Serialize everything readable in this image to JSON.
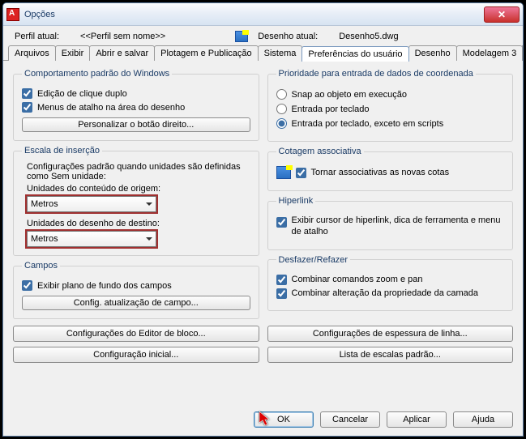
{
  "window": {
    "title": "Opções"
  },
  "header": {
    "profile_label": "Perfil atual:",
    "profile_value": "<<Perfil sem nome>>",
    "drawing_label": "Desenho atual:",
    "drawing_value": "Desenho5.dwg"
  },
  "tabs": {
    "items": [
      "Arquivos",
      "Exibir",
      "Abrir e salvar",
      "Plotagem e Publicação",
      "Sistema",
      "Preferências do usuário",
      "Desenho",
      "Modelagem 3"
    ],
    "active_index": 5
  },
  "left": {
    "win_behavior": {
      "legend": "Comportamento padrão do Windows",
      "dbl_click": "Edição de clique duplo",
      "shortcut_menus": "Menus de atalho na área do desenho",
      "custom_btn": "Personalizar o botão direito..."
    },
    "insert_scale": {
      "legend": "Escala de inserção",
      "desc": "Configurações padrão quando unidades são definidas como Sem unidade:",
      "src_label": "Unidades do conteúdo de origem:",
      "src_value": "Metros",
      "tgt_label": "Unidades do desenho de destino:",
      "tgt_value": "Metros"
    },
    "fields": {
      "legend": "Campos",
      "show_bg": "Exibir plano de fundo dos campos",
      "update_btn": "Config. atualização de campo..."
    }
  },
  "right": {
    "priority": {
      "legend": "Prioridade para entrada de dados de coordenada",
      "opt1": "Snap ao objeto em execução",
      "opt2": "Entrada por teclado",
      "opt3": "Entrada por teclado, exceto em scripts"
    },
    "assoc": {
      "legend": "Cotagem associativa",
      "label": "Tornar associativas as novas cotas"
    },
    "hyperlink": {
      "legend": "Hiperlink",
      "label": "Exibir cursor de hiperlink, dica de ferramenta e menu de atalho"
    },
    "undo": {
      "legend": "Desfazer/Refazer",
      "zoom_pan": "Combinar comandos zoom e pan",
      "layer_prop": "Combinar alteração da propriedade da camada"
    }
  },
  "bottom": {
    "block_editor": "Configurações do Editor de bloco...",
    "lineweight": "Configurações de espessura de linha...",
    "initial_setup": "Configuração inicial...",
    "scale_list": "Lista de escalas padrão..."
  },
  "footer": {
    "ok": "OK",
    "cancel": "Cancelar",
    "apply": "Aplicar",
    "help": "Ajuda"
  }
}
